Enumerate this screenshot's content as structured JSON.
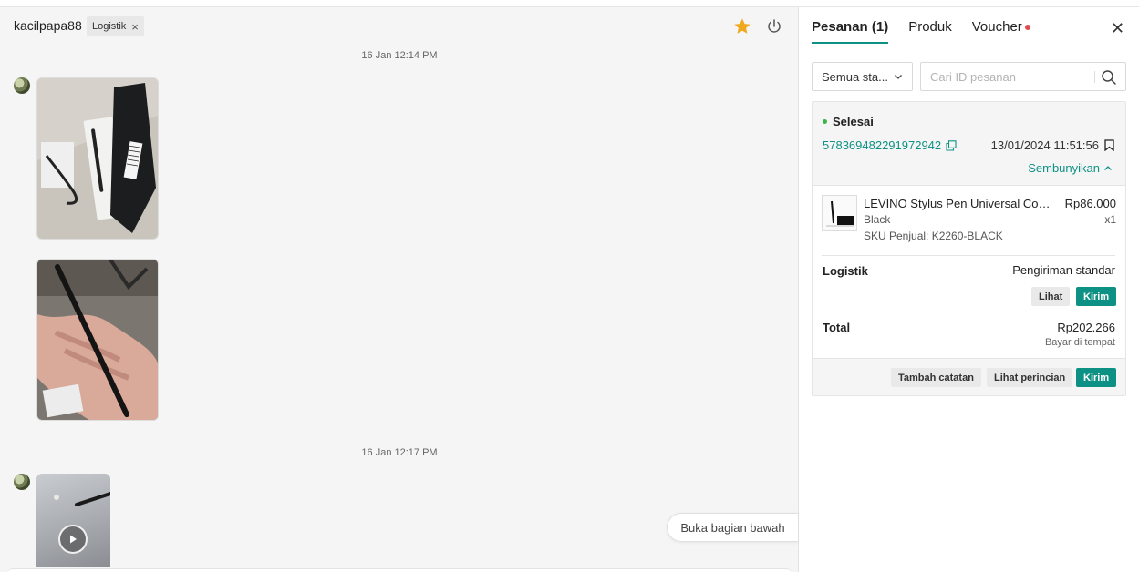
{
  "chat": {
    "username": "kacilpapa88",
    "tag_label": "Logistik",
    "timestamps": [
      "16 Jan 12:14 PM",
      "16 Jan 12:17 PM"
    ],
    "jump_to_bottom": "Buka bagian bawah"
  },
  "panel": {
    "tabs": [
      {
        "label": "Pesanan (1)"
      },
      {
        "label": "Produk"
      },
      {
        "label": "Voucher"
      }
    ],
    "filter_label": "Semua sta...",
    "search_placeholder": "Cari ID pesanan",
    "order": {
      "status": "Selesai",
      "order_id": "578369482291972942",
      "date": "13/01/2024 11:51:56",
      "hide_label": "Sembunyikan",
      "product": {
        "name": "LEVINO Stylus Pen Universal Com...",
        "price": "Rp86.000",
        "variant": "Black",
        "qty": "x1",
        "sku": "SKU Penjual: K2260-BLACK"
      },
      "logistics_label": "Logistik",
      "logistics_value": "Pengiriman standar",
      "view_label": "Lihat",
      "send_label": "Kirim",
      "total_label": "Total",
      "total_value": "Rp202.266",
      "payment_method": "Bayar di tempat",
      "add_note_label": "Tambah catatan",
      "view_detail_label": "Lihat perincian",
      "send_label_footer": "Kirim"
    }
  },
  "colors": {
    "accent": "#0e9185",
    "star": "#f0a81c",
    "status_dot": "#3ab54a",
    "notification_dot": "#e04c4c"
  }
}
